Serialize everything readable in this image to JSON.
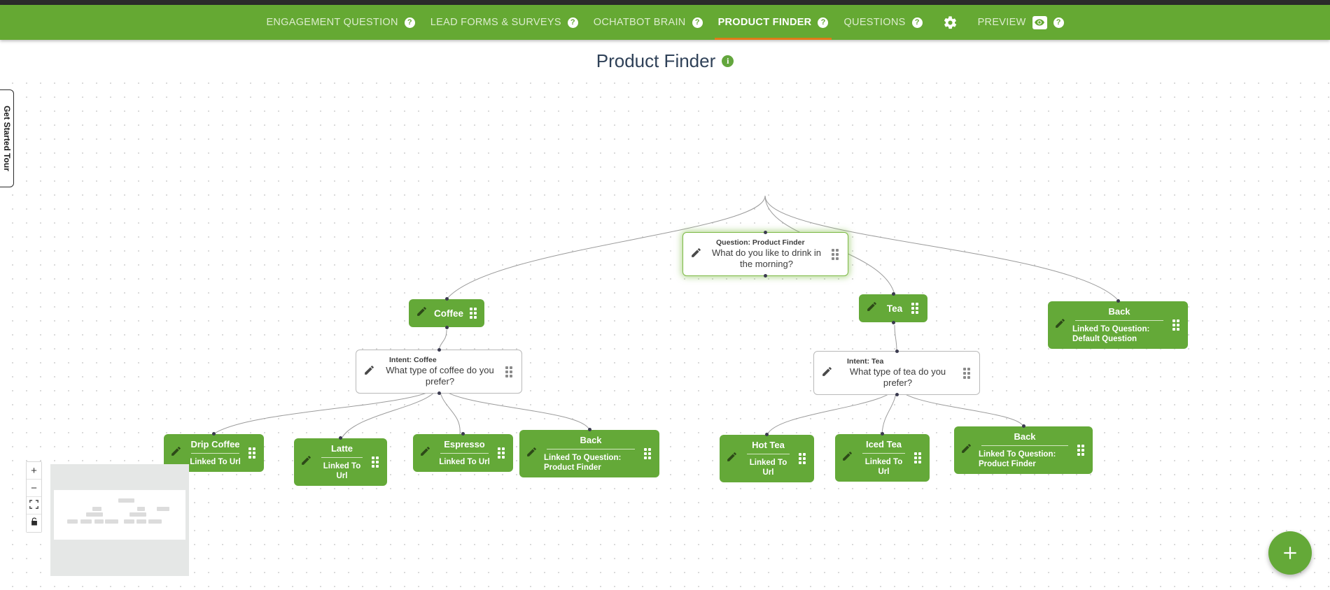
{
  "nav": {
    "items": [
      {
        "label": "ENGAGEMENT QUESTION",
        "active": false,
        "help": "?"
      },
      {
        "label": "LEAD FORMS & SURVEYS",
        "active": false,
        "help": "?"
      },
      {
        "label": "OCHATBOT BRAIN",
        "active": false,
        "help": "?"
      },
      {
        "label": "PRODUCT FINDER",
        "active": true,
        "help": "?"
      },
      {
        "label": "QUESTIONS",
        "active": false,
        "help": "?"
      }
    ],
    "settings_icon": "gear-icon",
    "preview": {
      "label": "PREVIEW",
      "icon": "eye-icon",
      "help": "?"
    }
  },
  "header": {
    "title": "Product Finder",
    "info_icon": "i"
  },
  "tour": {
    "label": "Get Started Tour"
  },
  "zoom_controls": {
    "zoom_in": "+",
    "zoom_out": "−",
    "fit": "fit-to-screen",
    "lock": "lock"
  },
  "fab": {
    "label": "+"
  },
  "flow": {
    "root": {
      "kicker": "Question: Product Finder",
      "text": "What do you like to drink in the morning?"
    },
    "answers": [
      {
        "id": "coffee",
        "title": "Coffee"
      },
      {
        "id": "tea",
        "title": "Tea"
      }
    ],
    "top_back": {
      "title": "Back",
      "sub": "Linked To Question: Default Question"
    },
    "intents": [
      {
        "id": "intent-coffee",
        "kicker": "Intent: Coffee",
        "text": "What type of coffee do you prefer?"
      },
      {
        "id": "intent-tea",
        "kicker": "Intent: Tea",
        "text": "What type of tea do you prefer?"
      }
    ],
    "coffee_children": [
      {
        "id": "drip-coffee",
        "title": "Drip Coffee",
        "sub": "Linked To Url",
        "align": "center"
      },
      {
        "id": "latte",
        "title": "Latte",
        "sub": "Linked To Url",
        "align": "center"
      },
      {
        "id": "espresso",
        "title": "Espresso",
        "sub": "Linked To Url",
        "align": "center"
      },
      {
        "id": "coffee-back",
        "title": "Back",
        "sub": "Linked To Question: Product Finder",
        "align": "left"
      }
    ],
    "tea_children": [
      {
        "id": "hot-tea",
        "title": "Hot Tea",
        "sub": "Linked To Url",
        "align": "center"
      },
      {
        "id": "iced-tea",
        "title": "Iced Tea",
        "sub": "Linked To Url",
        "align": "center"
      },
      {
        "id": "tea-back",
        "title": "Back",
        "sub": "Linked To Question: Product Finder",
        "align": "left"
      }
    ]
  },
  "colors": {
    "brand_green": "#65a933",
    "node_green": "#64a938",
    "accent_orange": "#e07b18",
    "title_navy": "#2f4158"
  }
}
